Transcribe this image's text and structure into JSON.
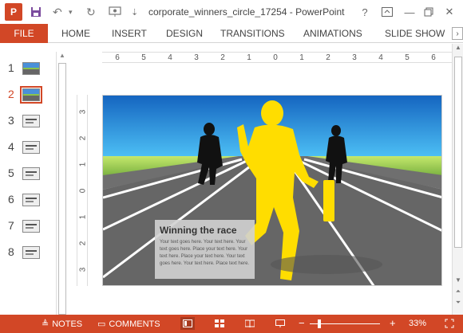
{
  "titlebar": {
    "app_icon": "P",
    "document_title": "corporate_winners_circle_17254 - PowerPoint",
    "help": "?",
    "icons": [
      "save-icon",
      "undo-icon",
      "redo-icon",
      "present-icon",
      "customize-icon"
    ]
  },
  "ribbon": {
    "file": "FILE",
    "tabs": [
      "HOME",
      "INSERT",
      "DESIGN",
      "TRANSITIONS",
      "ANIMATIONS",
      "SLIDE SHOW"
    ]
  },
  "thumbnails": [
    {
      "number": "1",
      "selected": false
    },
    {
      "number": "2",
      "selected": true
    },
    {
      "number": "3",
      "selected": false
    },
    {
      "number": "4",
      "selected": false
    },
    {
      "number": "5",
      "selected": false
    },
    {
      "number": "6",
      "selected": false
    },
    {
      "number": "7",
      "selected": false
    },
    {
      "number": "8",
      "selected": false
    }
  ],
  "ruler": {
    "horizontal": [
      "6",
      "5",
      "4",
      "3",
      "2",
      "1",
      "0",
      "1",
      "2",
      "3",
      "4",
      "5",
      "6"
    ],
    "vertical": [
      "3",
      "2",
      "1",
      "0",
      "1",
      "2",
      "3"
    ]
  },
  "slide": {
    "title": "Winning the race",
    "body": "Your text goes here. Your text here. Your text goes here. Place your text here. Your text here. Place your text here. Your text goes here. Your text here. Place text here."
  },
  "status": {
    "notes": "NOTES",
    "comments": "COMMENTS",
    "zoom": "33%"
  },
  "colors": {
    "accent": "#d24726",
    "sky": "#1e88e5",
    "grass": "#8bc34a",
    "track": "#666666",
    "runner_highlight": "#ffdd00"
  }
}
